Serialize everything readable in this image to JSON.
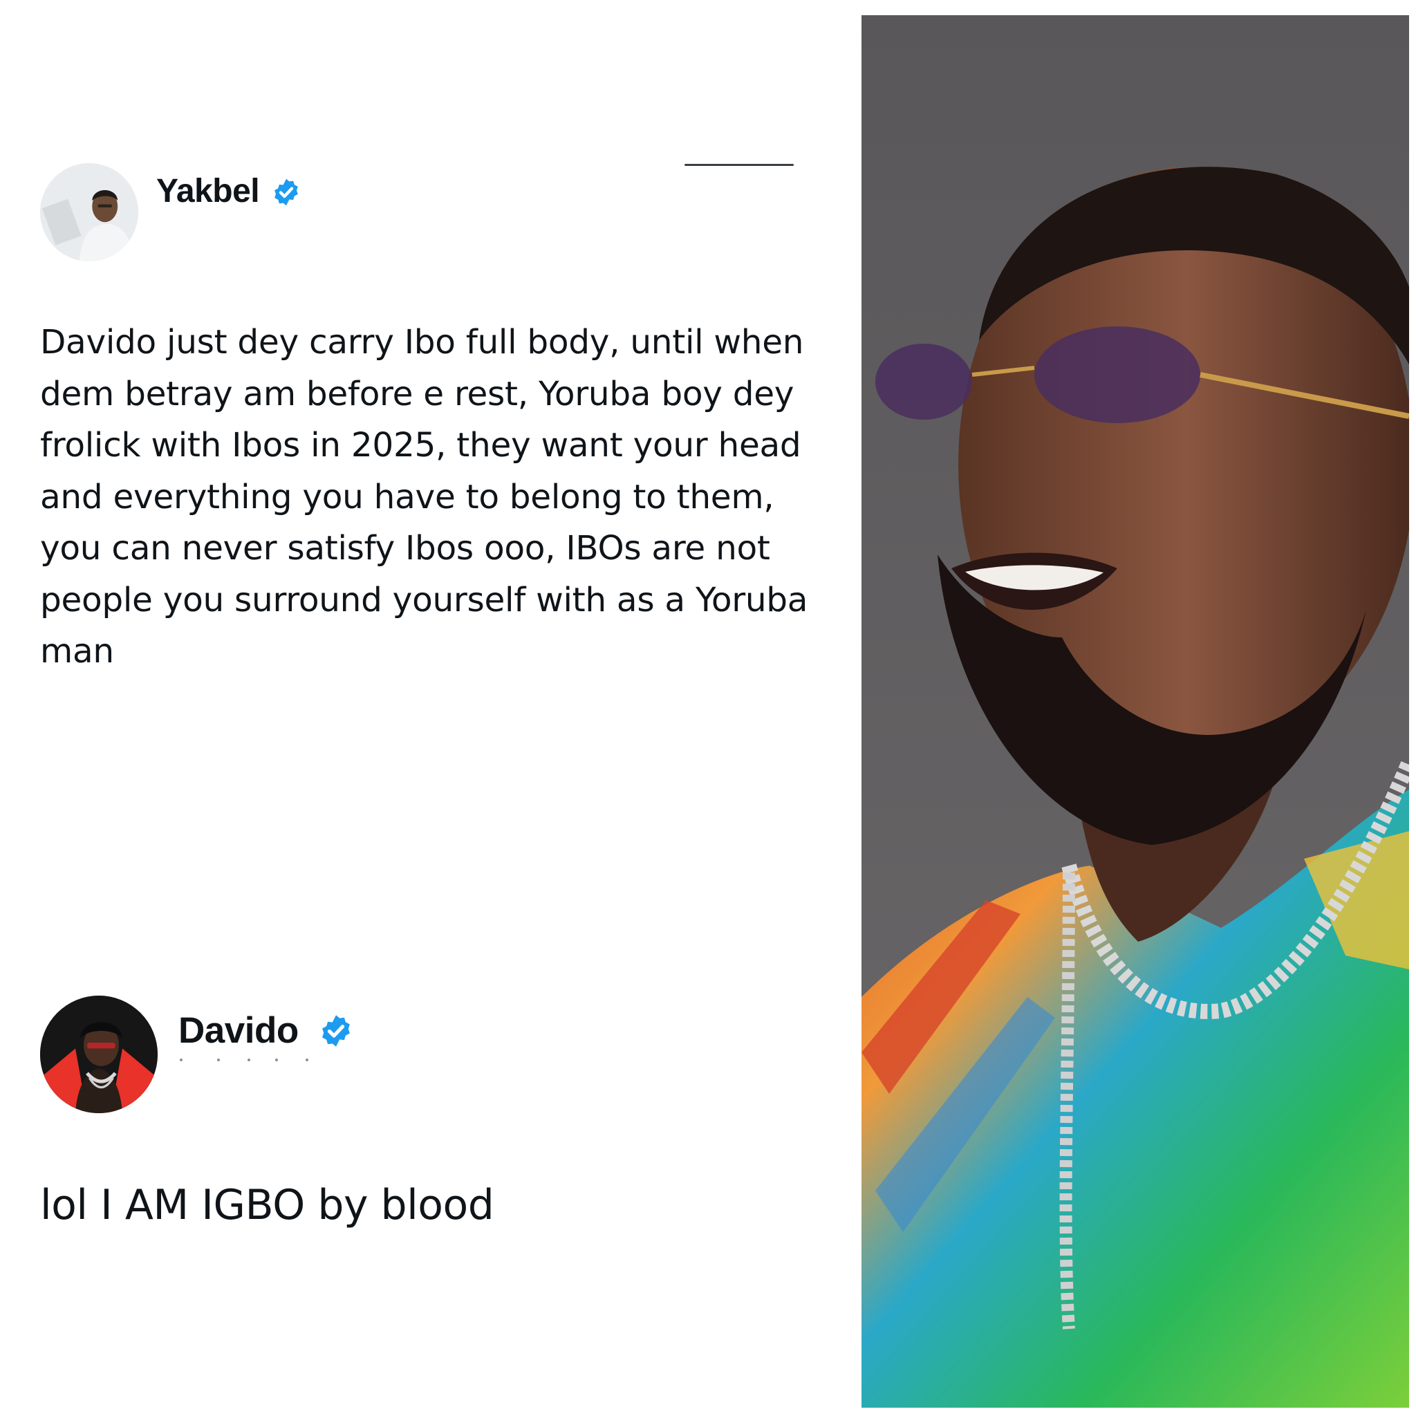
{
  "tweets": [
    {
      "author": "Yakbel",
      "verified": true,
      "avatar_icon": "profile-photo-man-white-shirt",
      "text": "Davido just dey carry Ibo full body, until when dem betray am before e rest, Yoruba boy dey frolick with Ibos in 2025, they want your head and everything you have to belong to them, you can never satisfy Ibos ooo, IBOs are not people you surround yourself with as a Yoruba man"
    },
    {
      "author": "Davido",
      "verified": true,
      "avatar_icon": "profile-photo-man-red-jacket",
      "text": "lol I AM IGBO by blood"
    }
  ],
  "photo": {
    "icon": "portrait-photo-smiling-man-sunglasses"
  },
  "colors": {
    "verified_badge": "#1d9bf0",
    "text": "#0f1419",
    "background": "#ffffff",
    "photo_background": "#5f5e60"
  }
}
